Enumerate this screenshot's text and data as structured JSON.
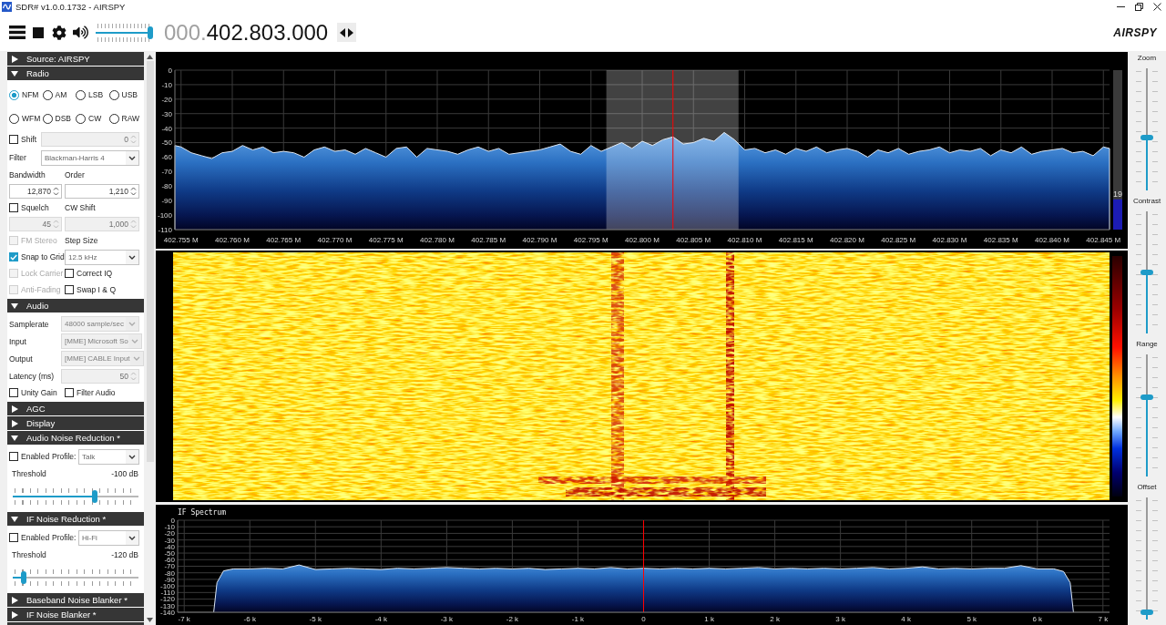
{
  "window": {
    "title": "SDR# v1.0.0.1732 - AIRSPY"
  },
  "toolbar": {
    "volume": {
      "level": 1
    },
    "frequency_prefix": "000.",
    "frequency": "402.803.000",
    "logo": "AIRSPY"
  },
  "sidebar": {
    "sections": [
      {
        "title": "Source: AIRSPY",
        "expanded": false
      },
      {
        "title": "Radio",
        "expanded": true,
        "rows": [
          {
            "kind": "modes",
            "cells": [
              {
                "kind": "radio",
                "label": "NFM",
                "selected": true
              },
              {
                "kind": "radio",
                "label": "AM",
                "selected": false
              },
              {
                "kind": "radio",
                "label": "LSB",
                "selected": false
              },
              {
                "kind": "radio",
                "label": "USB",
                "selected": false
              }
            ]
          },
          {
            "kind": "modes",
            "cells": [
              {
                "kind": "radio",
                "label": "WFM",
                "selected": false
              },
              {
                "kind": "radio",
                "label": "DSB",
                "selected": false
              },
              {
                "kind": "radio",
                "label": "CW",
                "selected": false
              },
              {
                "kind": "radio",
                "label": "RAW",
                "selected": false
              }
            ]
          },
          {
            "kind": "wide",
            "cells": [
              {
                "kind": "checkbox",
                "label": "Shift",
                "checked": false,
                "disabled": false
              },
              {
                "kind": "spin",
                "value": "0",
                "disabled": true
              }
            ]
          },
          {
            "kind": "wide",
            "cells": [
              {
                "kind": "label",
                "text": "Filter"
              },
              {
                "kind": "select",
                "value": "Blackman-Harris 4",
                "disabled": false
              }
            ]
          },
          {
            "kind": "pair",
            "cells": [
              {
                "kind": "label",
                "text": "Bandwidth"
              },
              {
                "kind": "label",
                "text": "Order"
              }
            ]
          },
          {
            "kind": "pair",
            "cells": [
              {
                "kind": "spin",
                "value": "12,870",
                "disabled": false
              },
              {
                "kind": "spin",
                "value": "1,210",
                "disabled": false
              }
            ]
          },
          {
            "kind": "pair",
            "cells": [
              {
                "kind": "checkbox",
                "label": "Squelch",
                "checked": false,
                "disabled": false
              },
              {
                "kind": "label",
                "text": "CW Shift"
              }
            ]
          },
          {
            "kind": "pair",
            "cells": [
              {
                "kind": "spin",
                "value": "45",
                "disabled": true
              },
              {
                "kind": "spin",
                "value": "1,000",
                "disabled": true
              }
            ]
          },
          {
            "kind": "pair",
            "cells": [
              {
                "kind": "checkbox",
                "label": "FM Stereo",
                "checked": false,
                "disabled": true
              },
              {
                "kind": "label",
                "text": "Step Size"
              }
            ]
          },
          {
            "kind": "pair",
            "cells": [
              {
                "kind": "checkbox",
                "label": "Snap to Grid",
                "checked": true,
                "disabled": false
              },
              {
                "kind": "select",
                "value": "12.5 kHz",
                "disabled": false
              }
            ]
          },
          {
            "kind": "pair",
            "cells": [
              {
                "kind": "checkbox",
                "label": "Lock Carrier",
                "checked": false,
                "disabled": true
              },
              {
                "kind": "checkbox",
                "label": "Correct IQ",
                "checked": false,
                "disabled": false
              }
            ]
          },
          {
            "kind": "pair",
            "cells": [
              {
                "kind": "checkbox",
                "label": "Anti-Fading",
                "checked": false,
                "disabled": true
              },
              {
                "kind": "checkbox",
                "label": "Swap I & Q",
                "checked": false,
                "disabled": false
              }
            ]
          }
        ]
      },
      {
        "title": "Audio",
        "expanded": true,
        "rows": [
          {
            "kind": "field",
            "cells": [
              {
                "kind": "label",
                "text": "Samplerate"
              },
              {
                "kind": "select",
                "value": "48000 sample/sec",
                "disabled": true
              }
            ]
          },
          {
            "kind": "field",
            "cells": [
              {
                "kind": "label",
                "text": "Input"
              },
              {
                "kind": "select",
                "value": "[MME] Microsoft So",
                "disabled": true
              }
            ]
          },
          {
            "kind": "field",
            "cells": [
              {
                "kind": "label",
                "text": "Output"
              },
              {
                "kind": "select",
                "value": "[MME] CABLE Input",
                "disabled": true
              }
            ]
          },
          {
            "kind": "field",
            "cells": [
              {
                "kind": "label",
                "text": "Latency (ms)"
              },
              {
                "kind": "spin",
                "value": "50",
                "disabled": true
              }
            ]
          },
          {
            "kind": "pair",
            "cells": [
              {
                "kind": "checkbox",
                "label": "Unity Gain",
                "checked": false,
                "disabled": false
              },
              {
                "kind": "checkbox",
                "label": "Filter Audio",
                "checked": false,
                "disabled": false
              }
            ]
          }
        ]
      },
      {
        "title": "AGC",
        "expanded": false
      },
      {
        "title": "Display",
        "expanded": false
      },
      {
        "title": "Audio Noise Reduction *",
        "expanded": true,
        "rows": [
          {
            "kind": "profile",
            "cells": [
              {
                "kind": "checkbox",
                "label": "Enabled",
                "checked": false,
                "disabled": false
              },
              {
                "kind": "label",
                "text": "Profile:"
              },
              {
                "kind": "select",
                "value": "Talk",
                "disabled": false
              }
            ]
          },
          {
            "kind": "threshold",
            "cells": [
              {
                "kind": "label",
                "text": "Threshold"
              },
              {
                "kind": "label",
                "text": "-100 dB"
              }
            ]
          },
          {
            "kind": "slider",
            "cells": [
              {
                "kind": "slider",
                "level": 0.66
              }
            ]
          }
        ]
      },
      {
        "title": "IF Noise Reduction *",
        "expanded": true,
        "rows": [
          {
            "kind": "profile",
            "cells": [
              {
                "kind": "checkbox",
                "label": "Enabled",
                "checked": false,
                "disabled": false
              },
              {
                "kind": "label",
                "text": "Profile:"
              },
              {
                "kind": "select",
                "value": "Hi-Fi",
                "disabled": false
              }
            ]
          },
          {
            "kind": "threshold",
            "cells": [
              {
                "kind": "label",
                "text": "Threshold"
              },
              {
                "kind": "label",
                "text": "-120 dB"
              }
            ]
          },
          {
            "kind": "slider",
            "cells": [
              {
                "kind": "slider",
                "level": 0.07
              }
            ]
          }
        ]
      },
      {
        "title": "Baseband Noise Blanker *",
        "expanded": false
      },
      {
        "title": "IF Noise Blanker *",
        "expanded": false
      }
    ]
  },
  "spectrum": {
    "chart_data": [
      {
        "type": "area",
        "color": "#dce6f2",
        "x": [
          402.7544,
          402.7544,
          402.755,
          402.756,
          402.757,
          402.758,
          402.759,
          402.76,
          402.761,
          402.762,
          402.763,
          402.764,
          402.765,
          402.766,
          402.767,
          402.768,
          402.769,
          402.77,
          402.771,
          402.772,
          402.773,
          402.774,
          402.775,
          402.776,
          402.777,
          402.778,
          402.779,
          402.78,
          402.781,
          402.782,
          402.783,
          402.784,
          402.785,
          402.786,
          402.787,
          402.788,
          402.789,
          402.79,
          402.791,
          402.792,
          402.793,
          402.794,
          402.795,
          402.796,
          402.797,
          402.798,
          402.799,
          402.8,
          402.801,
          402.802,
          402.803,
          402.804,
          402.805,
          402.806,
          402.807,
          402.808,
          402.809,
          402.81,
          402.811,
          402.812,
          402.813,
          402.814,
          402.815,
          402.816,
          402.817,
          402.818,
          402.819,
          402.82,
          402.821,
          402.822,
          402.823,
          402.824,
          402.825,
          402.826,
          402.827,
          402.828,
          402.829,
          402.83,
          402.831,
          402.832,
          402.833,
          402.834,
          402.835,
          402.836,
          402.837,
          402.838,
          402.839,
          402.84,
          402.841,
          402.842,
          402.843,
          402.844,
          402.845,
          402.8456,
          402.8456
        ],
        "values": [
          -110,
          -52,
          -53,
          -57,
          -59,
          -61,
          -57,
          -56,
          -52,
          -55,
          -53,
          -57,
          -56,
          -57,
          -60,
          -55,
          -53,
          -56,
          -55,
          -58,
          -54,
          -57,
          -60,
          -54,
          -53,
          -60,
          -54,
          -55,
          -56,
          -58,
          -55,
          -53,
          -56,
          -54,
          -58,
          -57,
          -56,
          -55,
          -53,
          -51,
          -56,
          -58,
          -52,
          -56,
          -53,
          -50,
          -54,
          -49,
          -52,
          -48,
          -46,
          -51,
          -50,
          -47,
          -49,
          -43,
          -48,
          -55,
          -54,
          -57,
          -55,
          -58,
          -54,
          -56,
          -53,
          -57,
          -55,
          -54,
          -56,
          -60,
          -55,
          -57,
          -54,
          -58,
          -56,
          -55,
          -53,
          -57,
          -55,
          -56,
          -54,
          -59,
          -55,
          -57,
          -53,
          -58,
          -56,
          -55,
          -54,
          -57,
          -56,
          -59,
          -53,
          -54,
          -110
        ],
        "xticks": [
          {
            "value": 402.755,
            "label": "402.755 M"
          },
          {
            "value": 402.76,
            "label": "402.760 M"
          },
          {
            "value": 402.765,
            "label": "402.765 M"
          },
          {
            "value": 402.77,
            "label": "402.770 M"
          },
          {
            "value": 402.775,
            "label": "402.775 M"
          },
          {
            "value": 402.78,
            "label": "402.780 M"
          },
          {
            "value": 402.785,
            "label": "402.785 M"
          },
          {
            "value": 402.79,
            "label": "402.790 M"
          },
          {
            "value": 402.795,
            "label": "402.795 M"
          },
          {
            "value": 402.8,
            "label": "402.800 M"
          },
          {
            "value": 402.805,
            "label": "402.805 M"
          },
          {
            "value": 402.81,
            "label": "402.810 M"
          },
          {
            "value": 402.815,
            "label": "402.815 M"
          },
          {
            "value": 402.82,
            "label": "402.820 M"
          },
          {
            "value": 402.825,
            "label": "402.825 M"
          },
          {
            "value": 402.83,
            "label": "402.830 M"
          },
          {
            "value": 402.835,
            "label": "402.835 M"
          },
          {
            "value": 402.84,
            "label": "402.840 M"
          },
          {
            "value": 402.845,
            "label": "402.845 M"
          }
        ],
        "yticks": [
          0,
          -10,
          -20,
          -30,
          -40,
          -50,
          -60,
          -70,
          -80,
          -90,
          -100,
          -110
        ],
        "xlim": [
          402.7544,
          402.8456
        ],
        "ylim": [
          -110,
          0
        ],
        "grid": true,
        "bands": [
          {
            "axis": "x",
            "from": 402.7965,
            "to": 402.8094,
            "color": "#ffffff"
          }
        ],
        "ref_lines": [
          {
            "axis": "x",
            "value": 402.803,
            "color": "#ff0000"
          }
        ]
      }
    ],
    "meter": {
      "reading": "19",
      "level": 0.19
    }
  },
  "if_spectrum": {
    "chart_data": [
      {
        "type": "area",
        "title": "IF Spectrum",
        "color": "#dce6f2",
        "x": [
          -6.55,
          -6.5,
          -6.4,
          -6.25,
          -6,
          -5.75,
          -5.5,
          -5.25,
          -5,
          -4.75,
          -4.5,
          -4.25,
          -4,
          -3.75,
          -3.5,
          -3.25,
          -3,
          -2.75,
          -2.5,
          -2.25,
          -2,
          -1.75,
          -1.5,
          -1.25,
          -1,
          -0.75,
          -0.5,
          -0.25,
          0,
          0.25,
          0.5,
          0.75,
          1,
          1.25,
          1.5,
          1.75,
          2,
          2.25,
          2.5,
          2.75,
          3,
          3.25,
          3.5,
          3.75,
          4,
          4.25,
          4.5,
          4.75,
          5,
          5.25,
          5.5,
          5.75,
          6,
          6.25,
          6.4,
          6.5,
          6.55
        ],
        "values": [
          -140,
          -95,
          -77,
          -74,
          -74,
          -73,
          -74,
          -68,
          -75,
          -74,
          -73,
          -74,
          -75,
          -73,
          -74,
          -73,
          -72,
          -73,
          -74,
          -73,
          -74,
          -73,
          -75,
          -74,
          -73,
          -74,
          -72,
          -74,
          -73,
          -74,
          -73,
          -74,
          -73,
          -74,
          -73,
          -72,
          -74,
          -73,
          -74,
          -73,
          -74,
          -73,
          -72,
          -74,
          -73,
          -71,
          -74,
          -73,
          -74,
          -73,
          -73,
          -69,
          -74,
          -74,
          -78,
          -95,
          -140
        ],
        "xticks": [
          {
            "value": -7,
            "label": "-7 k"
          },
          {
            "value": -6,
            "label": "-6 k"
          },
          {
            "value": -5,
            "label": "-5 k"
          },
          {
            "value": -4,
            "label": "-4 k"
          },
          {
            "value": -3,
            "label": "-3 k"
          },
          {
            "value": -2,
            "label": "-2 k"
          },
          {
            "value": -1,
            "label": "-1 k"
          },
          {
            "value": 0,
            "label": "0"
          },
          {
            "value": 1,
            "label": "1 k"
          },
          {
            "value": 2,
            "label": "2 k"
          },
          {
            "value": 3,
            "label": "3 k"
          },
          {
            "value": 4,
            "label": "4 k"
          },
          {
            "value": 5,
            "label": "5 k"
          },
          {
            "value": 6,
            "label": "6 k"
          },
          {
            "value": 7,
            "label": "7 k"
          }
        ],
        "yticks": [
          0,
          -10,
          -20,
          -30,
          -40,
          -50,
          -60,
          -70,
          -80,
          -90,
          -100,
          -110,
          -120,
          -130,
          -140
        ],
        "xlim": [
          -7.1,
          7.1
        ],
        "ylim": [
          -140,
          0
        ],
        "grid": true,
        "ref_lines": [
          {
            "axis": "x",
            "value": 0,
            "color": "#ff0000"
          }
        ]
      }
    ]
  },
  "view_sliders": [
    {
      "label": "Zoom",
      "level": 0.43
    },
    {
      "label": "Contrast",
      "level": 0.5
    },
    {
      "label": "Range",
      "level": 0.66
    },
    {
      "label": "Offset",
      "level": 0.04
    }
  ]
}
